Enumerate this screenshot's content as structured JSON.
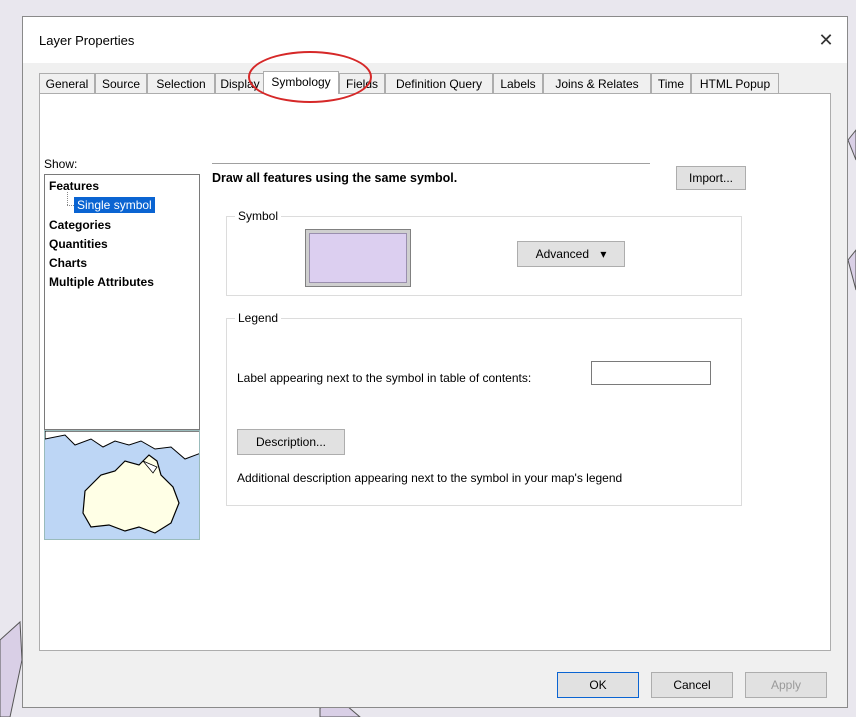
{
  "window": {
    "title": "Layer Properties",
    "close_glyph": "✕"
  },
  "tabs": [
    {
      "label": "General"
    },
    {
      "label": "Source"
    },
    {
      "label": "Selection"
    },
    {
      "label": "Display"
    },
    {
      "label": "Symbology",
      "active": true
    },
    {
      "label": "Fields"
    },
    {
      "label": "Definition Query"
    },
    {
      "label": "Labels"
    },
    {
      "label": "Joins & Relates"
    },
    {
      "label": "Time"
    },
    {
      "label": "HTML Popup"
    }
  ],
  "show": {
    "label": "Show:",
    "items": [
      "Features",
      "Single symbol",
      "Categories",
      "Quantities",
      "Charts",
      "Multiple Attributes"
    ],
    "selected": "Single symbol"
  },
  "main": {
    "description": "Draw all features using the same symbol.",
    "import_label": "Import...",
    "symbol": {
      "group_title": "Symbol",
      "swatch_color": "#dccff0",
      "advanced_label": "Advanced",
      "advanced_arrow": "▾"
    },
    "legend": {
      "group_title": "Legend",
      "label_prompt": "Label appearing next to the symbol in table of contents:",
      "label_value": "",
      "description_button": "Description...",
      "description_note": "Additional description appearing next to the symbol in your map's legend"
    }
  },
  "footer": {
    "ok": "OK",
    "cancel": "Cancel",
    "apply": "Apply"
  },
  "colors": {
    "highlight": "#d62828",
    "selection": "#0a64d2"
  },
  "icons": {
    "close": "close-icon",
    "dropdown": "chevron-down-icon",
    "map_thumbnail": "australia-map-thumbnail"
  }
}
